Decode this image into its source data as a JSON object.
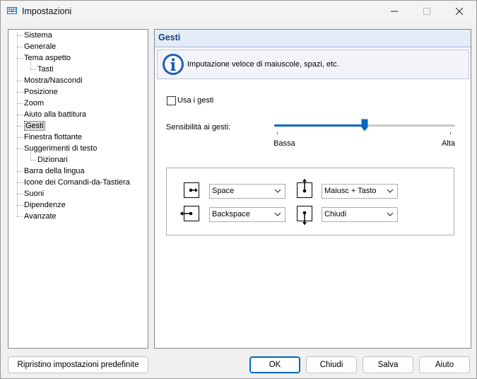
{
  "window": {
    "title": "Impostazioni",
    "app_icon": "keyboard-icon",
    "controls": [
      "minimize-icon",
      "maximize-icon",
      "close-icon"
    ]
  },
  "tree": {
    "items": [
      {
        "label": "Sistema",
        "level": 0
      },
      {
        "label": "Generale",
        "level": 0
      },
      {
        "label": "Tema aspetto",
        "level": 0
      },
      {
        "label": "Tasti",
        "level": 1
      },
      {
        "label": "Mostra/Nascondi",
        "level": 0
      },
      {
        "label": "Posizione",
        "level": 0
      },
      {
        "label": "Zoom",
        "level": 0
      },
      {
        "label": "Aiuto alla battitura",
        "level": 0
      },
      {
        "label": "Gesti",
        "level": 0,
        "selected": true
      },
      {
        "label": "Finestra flottante",
        "level": 0
      },
      {
        "label": "Suggerimenti di testo",
        "level": 0
      },
      {
        "label": "Dizionari",
        "level": 1
      },
      {
        "label": "Barra della lingua",
        "level": 0
      },
      {
        "label": "Icone dei Comandi-da-Tastiera",
        "level": 0
      },
      {
        "label": "Suoni",
        "level": 0
      },
      {
        "label": "Dipendenze",
        "level": 0
      },
      {
        "label": "Avanzate",
        "level": 0
      }
    ]
  },
  "panel": {
    "title": "Gesti",
    "info_icon": "info-icon",
    "info_text": "Imputazione veloce di maiuscole, spazi, etc.",
    "use_gestures": {
      "label": "Usa i gesti",
      "checked": false
    },
    "sensitivity": {
      "label": "Sensibilità ai gesti:",
      "low_label": "Bassa",
      "high_label": "Alta",
      "level": 0.5
    },
    "gestures": [
      {
        "icon": "swipe-right-icon",
        "value": "Space"
      },
      {
        "icon": "swipe-up-icon",
        "value": "Maiusc + Tasto"
      },
      {
        "icon": "swipe-left-icon",
        "value": "Backspace"
      },
      {
        "icon": "swipe-down-icon",
        "value": "Chiudi"
      }
    ]
  },
  "footer": {
    "reset_label": "Ripristino impostazioni predefinite",
    "ok_label": "OK",
    "close_label": "Chiudi",
    "save_label": "Salva",
    "help_label": "Aiuto"
  },
  "colors": {
    "accent": "#0067c0",
    "header_bg": "#e4ecf7",
    "header_text": "#1a3f7a"
  }
}
